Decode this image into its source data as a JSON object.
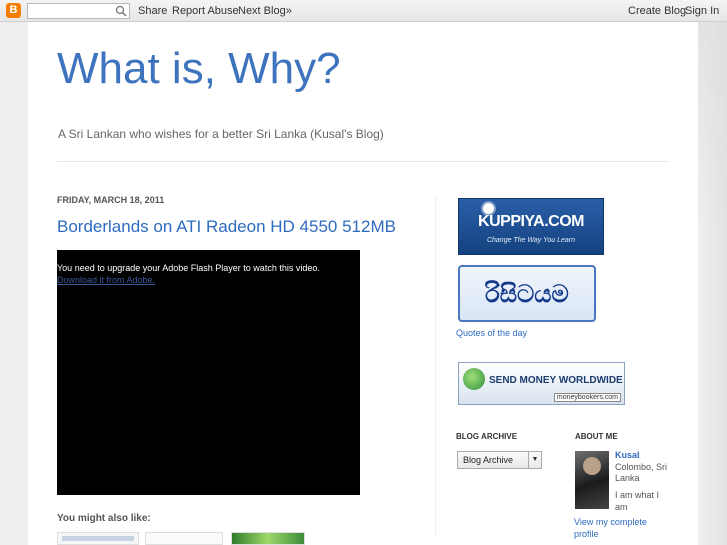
{
  "navbar": {
    "logo_glyph": "B",
    "search_placeholder": "",
    "share": "Share",
    "report_abuse": "Report Abuse",
    "next_blog": "Next Blog»",
    "create_blog": "Create Blog",
    "sign_in": "Sign In"
  },
  "header": {
    "title": "What is, Why?",
    "description": "A Sri Lankan who wishes for a better Sri Lanka (Kusal's Blog)"
  },
  "post": {
    "date": "FRIDAY, MARCH 18, 2011",
    "title": "Borderlands on ATI Radeon HD 4550 512MB",
    "video_message": "You need to upgrade your Adobe Flash Player to watch this video.",
    "video_link": "Download it from Adobe.",
    "you_might_like": "You might also like:"
  },
  "sidebar": {
    "kuppiya_logo": "KUPPIYA.COM",
    "kuppiya_tagline": "Change The Way You Learn",
    "quotes_script": "රිසිටයම",
    "quotes_link": "Quotes of the day",
    "money_text": "SEND MONEY WORLDWIDE",
    "money_brand": "moneybookers.com",
    "blog_archive_title": "BLOG ARCHIVE",
    "blog_archive_select": "Blog Archive",
    "about_title": "ABOUT ME",
    "about_name": "Kusal",
    "about_location": "Colombo, Sri Lanka",
    "about_desc": "I am what I am",
    "about_link": "View my complete profile"
  },
  "colors": {
    "title_blue": "#3d74bd",
    "link_blue": "#2e6bbf",
    "blogger_orange": "#f57d00"
  }
}
